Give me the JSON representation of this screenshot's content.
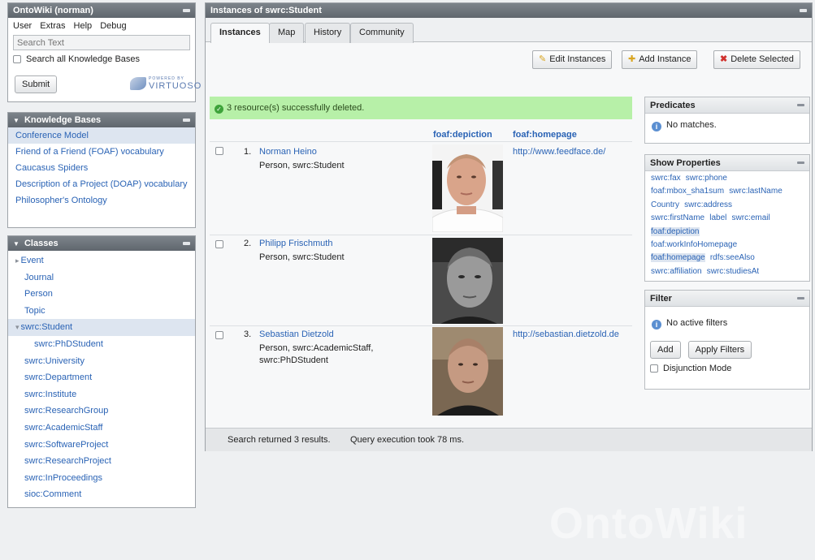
{
  "ontowiki": {
    "title": "OntoWiki (norman)",
    "menu": [
      "User",
      "Extras",
      "Help",
      "Debug"
    ],
    "search_placeholder": "Search Text",
    "search_all_label": "Search all Knowledge Bases",
    "submit_label": "Submit",
    "virtuoso_powered": "POWERED BY",
    "virtuoso_name": "VIRTUOSO"
  },
  "knowledge_bases": {
    "title": "Knowledge Bases",
    "items": [
      "Conference Model",
      "Friend of a Friend (FOAF) vocabulary",
      "Caucasus Spiders",
      "Description of a Project (DOAP) vocabulary",
      "Philosopher's Ontology"
    ],
    "selected_index": 0
  },
  "classes": {
    "title": "Classes",
    "items": [
      "Event",
      "Journal",
      "Person",
      "Topic",
      "swrc:Student",
      "swrc:PhDStudent",
      "swrc:University",
      "swrc:Department",
      "swrc:Institute",
      "swrc:ResearchGroup",
      "swrc:AcademicStaff",
      "swrc:SoftwareProject",
      "swrc:ResearchProject",
      "swrc:InProceedings",
      "sioc:Comment"
    ]
  },
  "main": {
    "title": "Instances of swrc:Student",
    "tabs": [
      "Instances",
      "Map",
      "History",
      "Community"
    ],
    "active_tab": "Instances",
    "toolbar": {
      "edit": "Edit Instances",
      "add": "Add Instance",
      "delete": "Delete Selected"
    },
    "message": "3 resource(s) successfully deleted.",
    "columns": {
      "depiction": "foaf:depiction",
      "homepage": "foaf:homepage"
    },
    "rows": [
      {
        "num": "1.",
        "name": "Norman Heino",
        "types": [
          "Person, swrc:Student"
        ],
        "homepage": "http://www.feedface.de/"
      },
      {
        "num": "2.",
        "name": "Philipp Frischmuth",
        "types": [
          "Person, swrc:Student"
        ],
        "homepage": ""
      },
      {
        "num": "3.",
        "name": "Sebastian Dietzold",
        "types": [
          "Person, swrc:AcademicStaff,",
          "swrc:PhDStudent"
        ],
        "homepage": "http://sebastian.dietzold.de"
      }
    ],
    "footer": {
      "results": "Search returned 3 results.",
      "timing": "Query execution took 78 ms."
    }
  },
  "predicates": {
    "title": "Predicates",
    "message": "No matches."
  },
  "show_properties": {
    "title": "Show Properties",
    "lines": [
      [
        "swrc:fax",
        "swrc:phone"
      ],
      [
        "foaf:mbox_sha1sum",
        "swrc:lastName"
      ],
      [
        "Country",
        "swrc:address"
      ],
      [
        "swrc:firstName",
        "label",
        "swrc:email"
      ],
      [
        "foaf:depiction"
      ],
      [
        "foaf:workInfoHomepage"
      ],
      [
        "foaf:homepage",
        "rdfs:seeAlso"
      ],
      [
        "swrc:affiliation",
        "swrc:studiesAt"
      ]
    ]
  },
  "filter": {
    "title": "Filter",
    "message": "No active filters",
    "add_label": "Add",
    "apply_label": "Apply Filters",
    "disjunction_label": "Disjunction Mode"
  },
  "watermark": "OntoWiki"
}
